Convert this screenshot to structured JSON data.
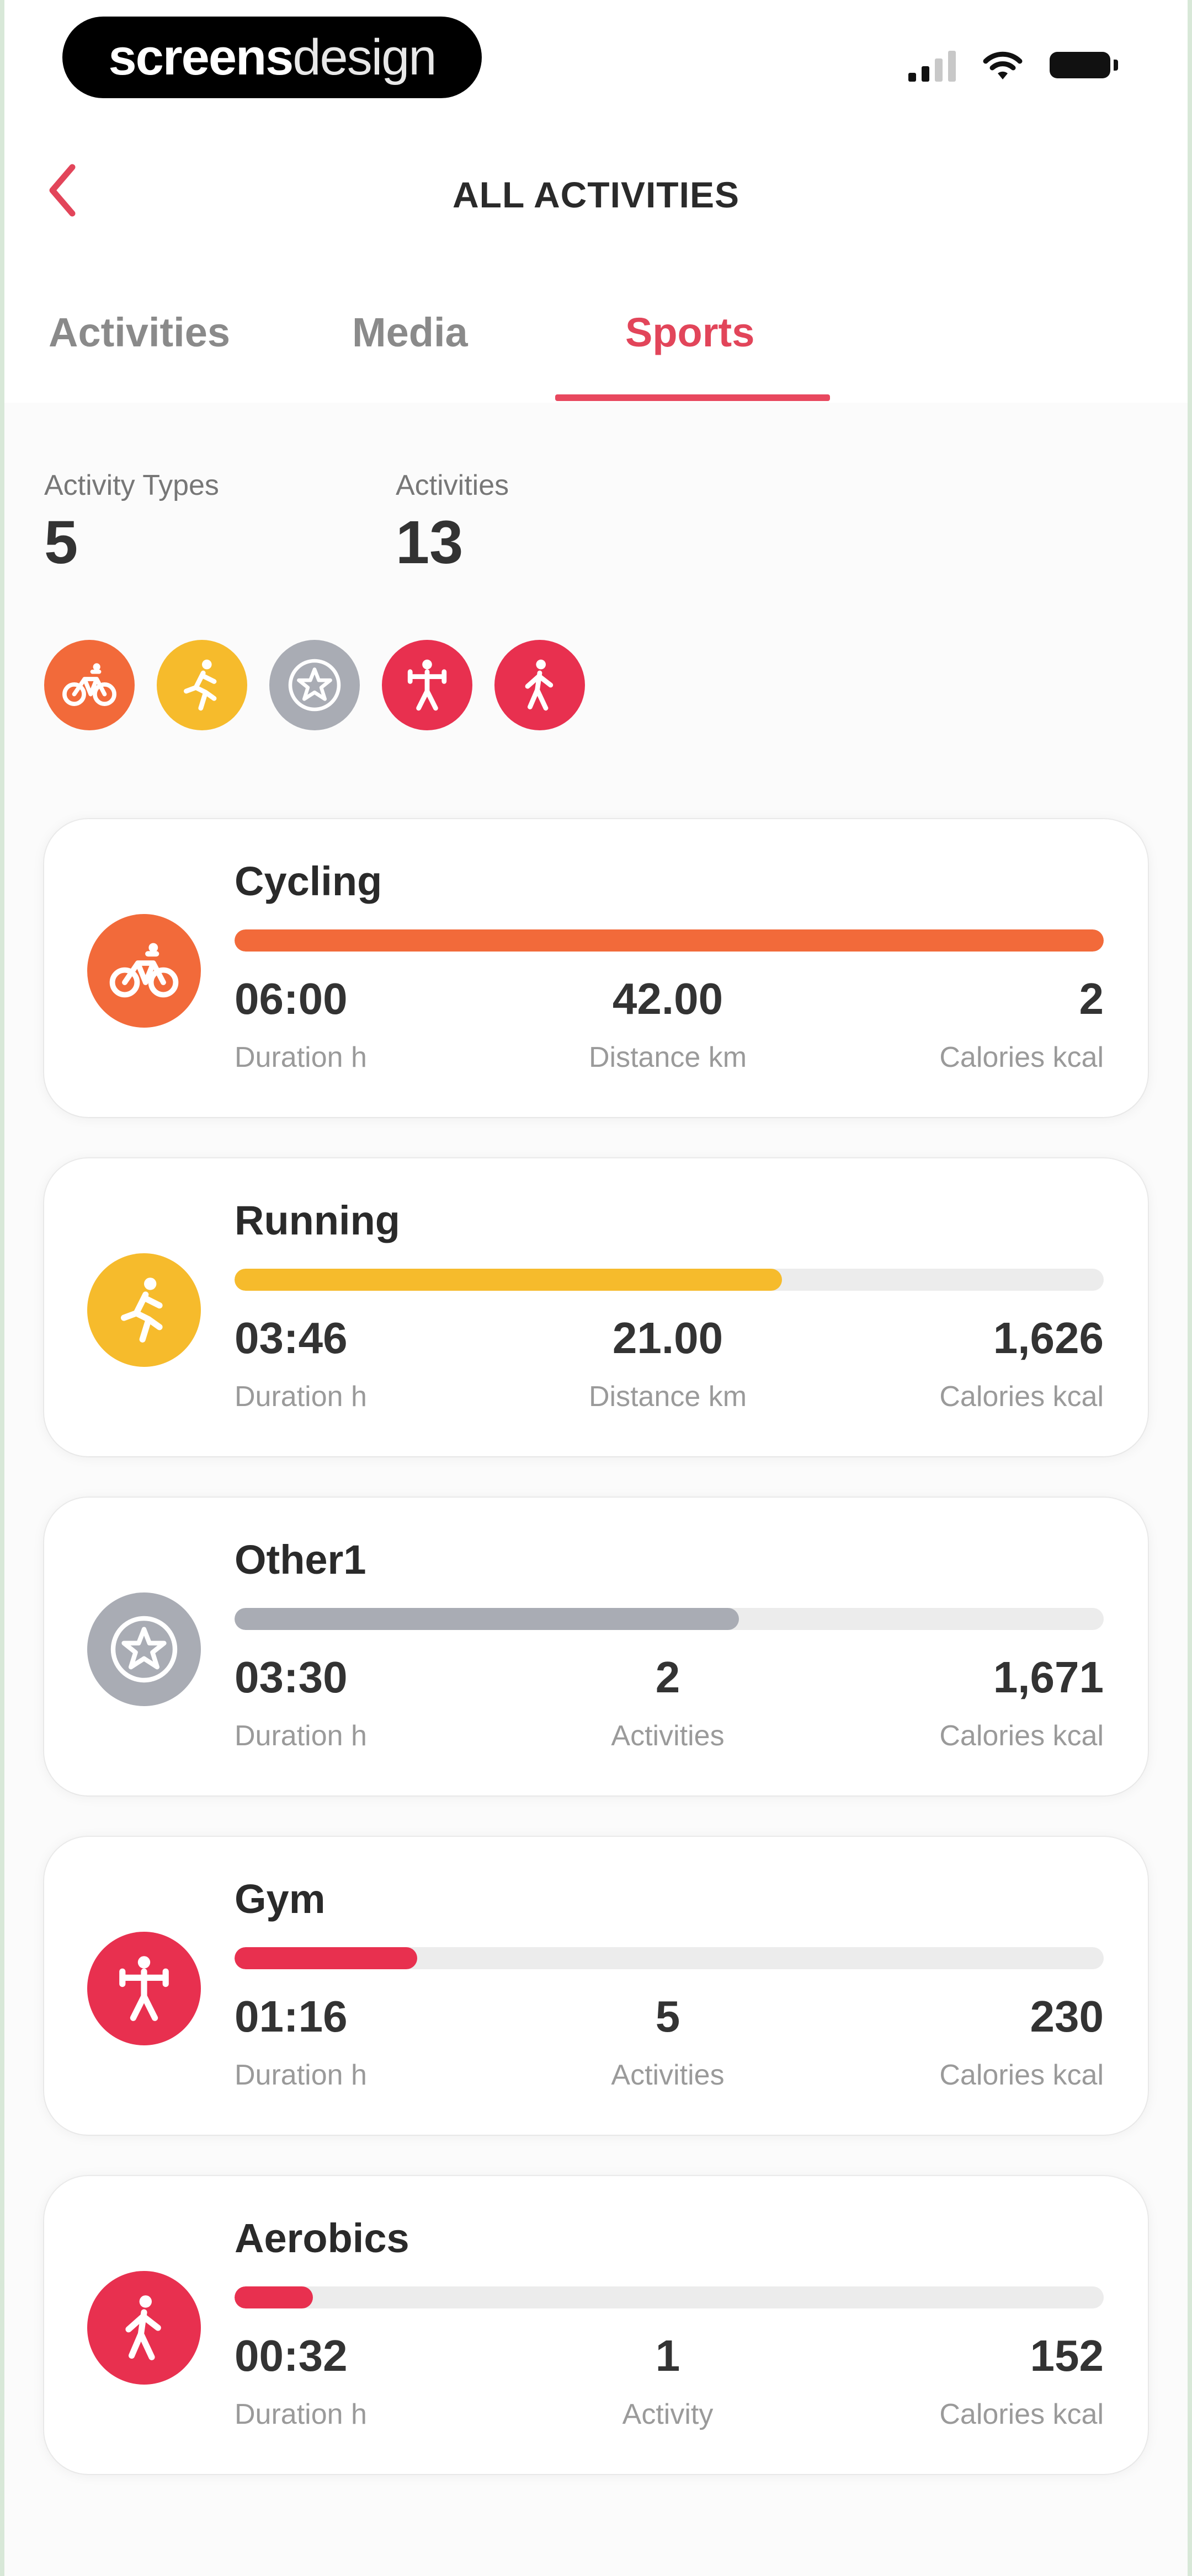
{
  "brand": {
    "bold": "screens",
    "light": "design"
  },
  "nav": {
    "title": "ALL ACTIVITIES"
  },
  "tabs": [
    {
      "label": "Activities"
    },
    {
      "label": "Media"
    },
    {
      "label": "Sports"
    }
  ],
  "summary": {
    "types_label": "Activity Types",
    "types_value": "5",
    "activities_label": "Activities",
    "activities_value": "13"
  },
  "colors": {
    "cycling": "#f26a3a",
    "running": "#f6bb2c",
    "other": "#a9acb4",
    "gym": "#e8304f",
    "aerobics": "#e8304f",
    "accent": "#e2455a"
  },
  "badges": [
    {
      "icon": "bicycle-icon"
    },
    {
      "icon": "running-icon"
    },
    {
      "icon": "star-icon"
    },
    {
      "icon": "gym-icon"
    },
    {
      "icon": "walking-icon"
    }
  ],
  "cards": [
    {
      "title": "Cycling",
      "icon": "bicycle-icon",
      "progress": 1.0,
      "s1_value": "06:00",
      "s1_label": "Duration h",
      "s2_value": "42.00",
      "s2_label": "Distance km",
      "s3_value": "2",
      "s3_label": "Calories kcal"
    },
    {
      "title": "Running",
      "icon": "running-icon",
      "progress": 0.63,
      "s1_value": "03:46",
      "s1_label": "Duration h",
      "s2_value": "21.00",
      "s2_label": "Distance km",
      "s3_value": "1,626",
      "s3_label": "Calories kcal"
    },
    {
      "title": "Other1",
      "icon": "star-icon",
      "progress": 0.58,
      "s1_value": "03:30",
      "s1_label": "Duration h",
      "s2_value": "2",
      "s2_label": "Activities",
      "s3_value": "1,671",
      "s3_label": "Calories kcal"
    },
    {
      "title": "Gym",
      "icon": "gym-icon",
      "progress": 0.21,
      "s1_value": "01:16",
      "s1_label": "Duration h",
      "s2_value": "5",
      "s2_label": "Activities",
      "s3_value": "230",
      "s3_label": "Calories kcal"
    },
    {
      "title": "Aerobics",
      "icon": "walking-icon",
      "progress": 0.09,
      "s1_value": "00:32",
      "s1_label": "Duration h",
      "s2_value": "1",
      "s2_label": "Activity",
      "s3_value": "152",
      "s3_label": "Calories kcal"
    }
  ]
}
